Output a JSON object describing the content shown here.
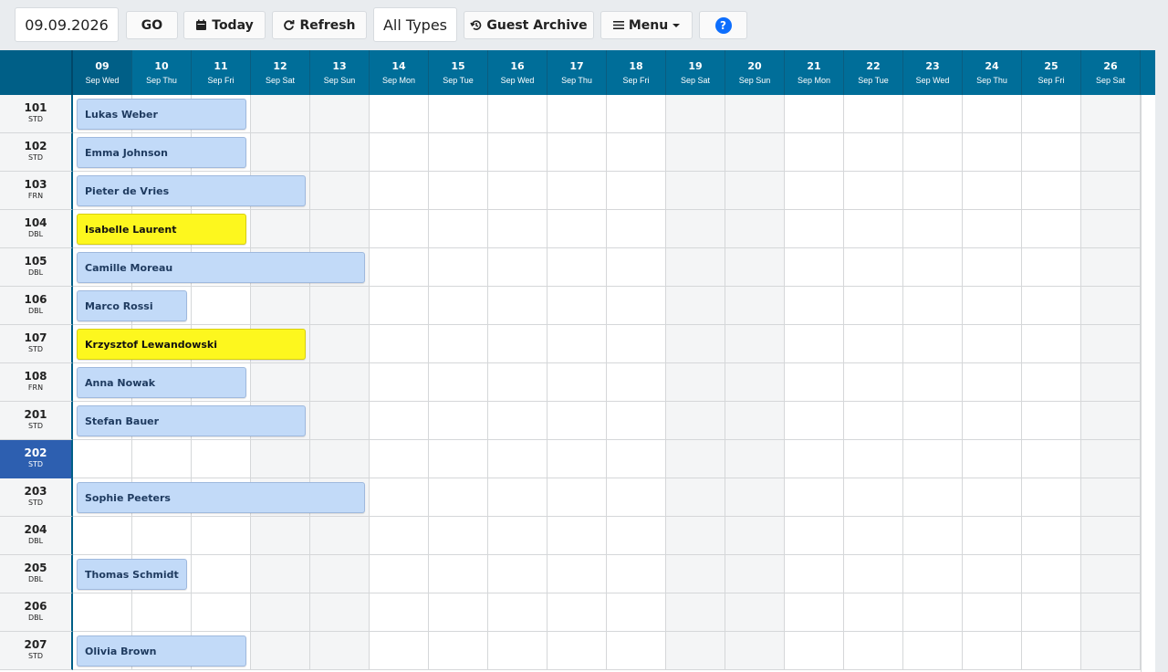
{
  "toolbar": {
    "date_value": "09.09.2026",
    "go_label": "GO",
    "today_label": "Today",
    "refresh_label": "Refresh",
    "type_filter_value": "All Types",
    "guest_archive_label": "Guest Archive",
    "menu_label": "Menu",
    "help_label": "?"
  },
  "days": [
    {
      "day": "09",
      "sub": "Sep Wed",
      "weekend": false
    },
    {
      "day": "10",
      "sub": "Sep Thu",
      "weekend": false
    },
    {
      "day": "11",
      "sub": "Sep Fri",
      "weekend": false
    },
    {
      "day": "12",
      "sub": "Sep Sat",
      "weekend": true
    },
    {
      "day": "13",
      "sub": "Sep Sun",
      "weekend": true
    },
    {
      "day": "14",
      "sub": "Sep Mon",
      "weekend": false
    },
    {
      "day": "15",
      "sub": "Sep Tue",
      "weekend": false
    },
    {
      "day": "16",
      "sub": "Sep Wed",
      "weekend": false
    },
    {
      "day": "17",
      "sub": "Sep Thu",
      "weekend": false
    },
    {
      "day": "18",
      "sub": "Sep Fri",
      "weekend": false
    },
    {
      "day": "19",
      "sub": "Sep Sat",
      "weekend": true
    },
    {
      "day": "20",
      "sub": "Sep Sun",
      "weekend": true
    },
    {
      "day": "21",
      "sub": "Sep Mon",
      "weekend": false
    },
    {
      "day": "22",
      "sub": "Sep Tue",
      "weekend": false
    },
    {
      "day": "23",
      "sub": "Sep Wed",
      "weekend": false
    },
    {
      "day": "24",
      "sub": "Sep Thu",
      "weekend": false
    },
    {
      "day": "25",
      "sub": "Sep Fri",
      "weekend": false
    },
    {
      "day": "26",
      "sub": "Sep Sat",
      "weekend": true
    }
  ],
  "rooms": [
    {
      "number": "101",
      "type": "STD",
      "selected": false,
      "booking": {
        "guest": "Lukas Weber",
        "start": 0,
        "nights": 3,
        "highlight": false
      }
    },
    {
      "number": "102",
      "type": "STD",
      "selected": false,
      "booking": {
        "guest": "Emma Johnson",
        "start": 0,
        "nights": 3,
        "highlight": false
      }
    },
    {
      "number": "103",
      "type": "FRN",
      "selected": false,
      "booking": {
        "guest": "Pieter de Vries",
        "start": 0,
        "nights": 4,
        "highlight": false
      }
    },
    {
      "number": "104",
      "type": "DBL",
      "selected": false,
      "booking": {
        "guest": "Isabelle Laurent",
        "start": 0,
        "nights": 3,
        "highlight": true
      }
    },
    {
      "number": "105",
      "type": "DBL",
      "selected": false,
      "booking": {
        "guest": "Camille Moreau",
        "start": 0,
        "nights": 5,
        "highlight": false
      }
    },
    {
      "number": "106",
      "type": "DBL",
      "selected": false,
      "booking": {
        "guest": "Marco Rossi",
        "start": 0,
        "nights": 2,
        "highlight": false
      }
    },
    {
      "number": "107",
      "type": "STD",
      "selected": false,
      "booking": {
        "guest": "Krzysztof Lewandowski",
        "start": 0,
        "nights": 4,
        "highlight": true
      }
    },
    {
      "number": "108",
      "type": "FRN",
      "selected": false,
      "booking": {
        "guest": "Anna Nowak",
        "start": 0,
        "nights": 3,
        "highlight": false
      }
    },
    {
      "number": "201",
      "type": "STD",
      "selected": false,
      "booking": {
        "guest": "Stefan Bauer",
        "start": 0,
        "nights": 4,
        "highlight": false
      }
    },
    {
      "number": "202",
      "type": "STD",
      "selected": true,
      "booking": null
    },
    {
      "number": "203",
      "type": "STD",
      "selected": false,
      "booking": {
        "guest": "Sophie Peeters",
        "start": 0,
        "nights": 5,
        "highlight": false
      }
    },
    {
      "number": "204",
      "type": "DBL",
      "selected": false,
      "booking": null
    },
    {
      "number": "205",
      "type": "DBL",
      "selected": false,
      "booking": {
        "guest": "Thomas Schmidt",
        "start": 0,
        "nights": 2,
        "highlight": false
      }
    },
    {
      "number": "206",
      "type": "DBL",
      "selected": false,
      "booking": null
    },
    {
      "number": "207",
      "type": "STD",
      "selected": false,
      "booking": {
        "guest": "Olivia Brown",
        "start": 0,
        "nights": 3,
        "highlight": false
      }
    }
  ],
  "colors": {
    "header": "#006e99",
    "booking": "#c2daf8",
    "booking_highlight": "#fdf71e",
    "selected_room": "#2d5fb0"
  }
}
